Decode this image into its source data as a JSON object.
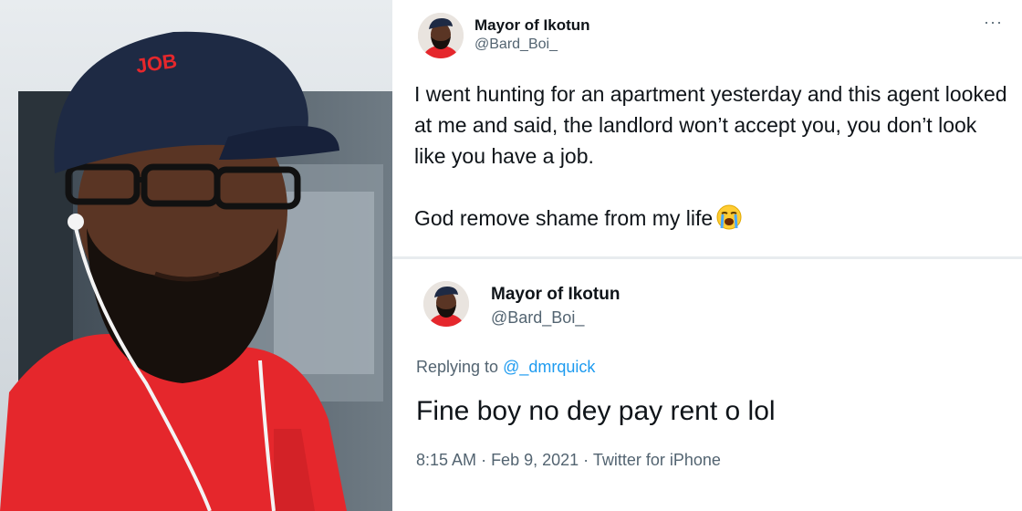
{
  "tweet": {
    "author_name": "Mayor of Ikotun",
    "author_handle": "@Bard_Boi_",
    "more_icon": "more-icon",
    "paragraph_1": "I went hunting for an apartment yesterday and this agent looked at me and said, the landlord won’t accept you, you don’t look like you have a job.",
    "paragraph_2": "God remove shame from my life",
    "emoji": "loudly-crying-face"
  },
  "reply": {
    "author_name": "Mayor of Ikotun",
    "author_handle": "@Bard_Boi_",
    "replying_prefix": "Replying to",
    "replying_to": "@_dmrquick",
    "text": "Fine boy no dey pay rent o lol",
    "time": "8:15 AM",
    "date": "Feb 9, 2021",
    "source": "Twitter for iPhone"
  },
  "photo": {
    "cap_text": "JOB",
    "colors": {
      "cap": "#1e2a44",
      "shirt": "#e5272c",
      "skin": "#5a3524"
    }
  },
  "colors": {
    "text": "#0f1419",
    "secondary": "#536471",
    "link": "#1d9bf0"
  }
}
